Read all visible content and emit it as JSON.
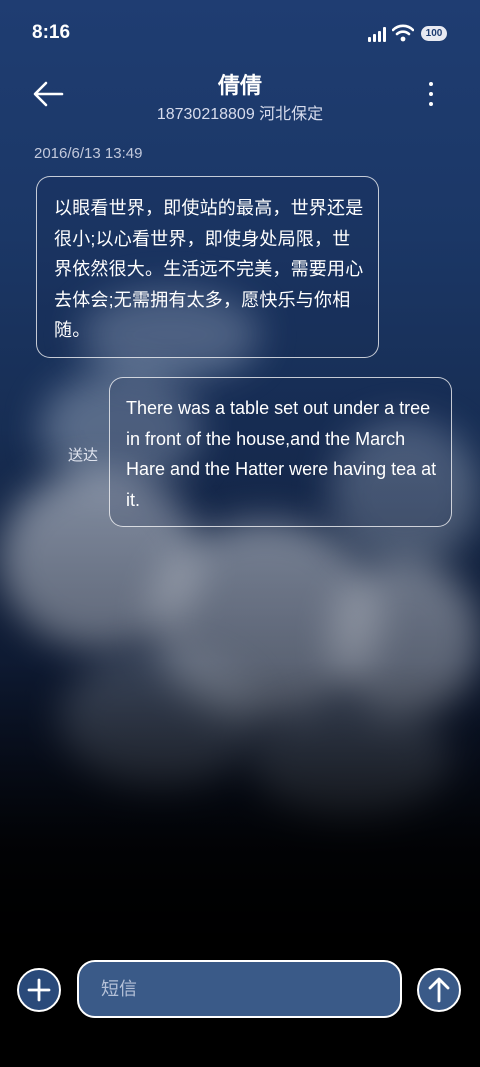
{
  "status_bar": {
    "time": "8:16",
    "battery": "100"
  },
  "header": {
    "contact_name": "倩倩",
    "contact_detail": "18730218809 河北保定",
    "back_icon": "arrow-left-icon",
    "more_icon": "more-vertical-icon"
  },
  "conversation": {
    "timestamp": "2016/6/13 13:49",
    "messages": [
      {
        "direction": "incoming",
        "text": "以眼看世界，即使站的最高，世界还是很小;以心看世界，即使身处局限，世界依然很大。生活远不完美，需要用心去体会;无需拥有太多，愿快乐与你相随。"
      },
      {
        "direction": "outgoing",
        "text": "There was a table set out under a tree in front of the house,and the March Hare and the Hatter were having tea at it.",
        "status": "送达"
      }
    ]
  },
  "composer": {
    "placeholder": "短信",
    "add_icon": "plus-icon",
    "send_icon": "arrow-up-icon"
  },
  "colors": {
    "accent": "#1f3d72",
    "input_bg": "#3a5a88"
  }
}
